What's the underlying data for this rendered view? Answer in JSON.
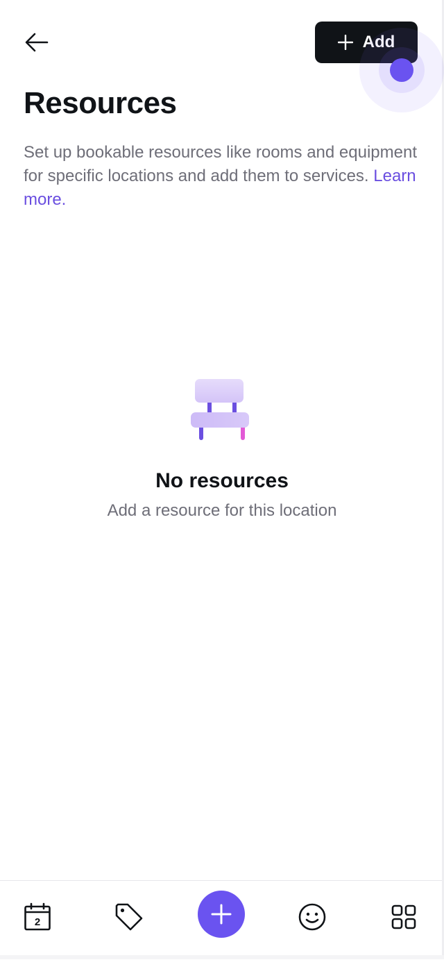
{
  "header": {
    "back_icon": "arrow-left-icon",
    "add_button_label": "Add",
    "add_icon": "plus-icon"
  },
  "page": {
    "title": "Resources",
    "description_text": "Set up bookable resources like rooms and equipment for specific locations and add them to services. ",
    "learn_more_label": "Learn more."
  },
  "empty_state": {
    "icon": "chair-icon",
    "title": "No resources",
    "subtitle": "Add a resource for this location"
  },
  "bottom_nav": {
    "items": [
      {
        "icon": "calendar-icon",
        "badge": "2"
      },
      {
        "icon": "tag-icon"
      },
      {
        "icon": "plus-icon"
      },
      {
        "icon": "smiley-icon"
      },
      {
        "icon": "grid-icon"
      }
    ]
  },
  "colors": {
    "accent": "#6a53f0",
    "button_dark": "#101317",
    "muted_text": "#6e6e78",
    "link": "#6a4ee0"
  }
}
